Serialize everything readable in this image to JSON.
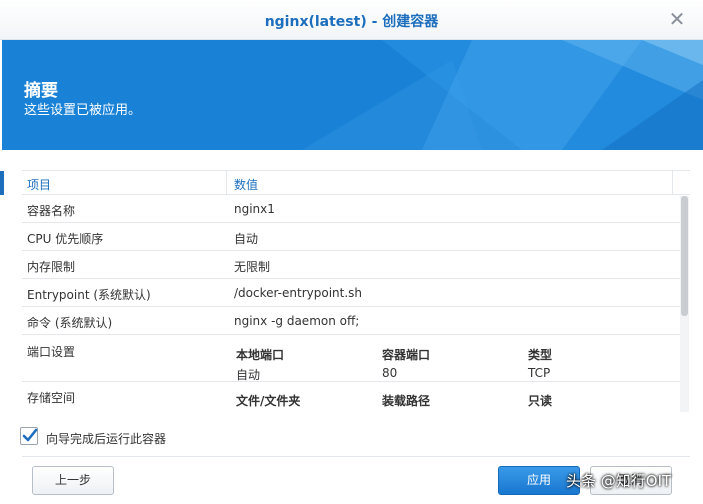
{
  "window": {
    "title": "nginx(latest) - 创建容器",
    "close_glyph": "✕"
  },
  "banner": {
    "heading": "摘要",
    "subheading": "这些设置已被应用。"
  },
  "table": {
    "headers": {
      "item": "项目",
      "value": "数值"
    },
    "rows": [
      {
        "key": "容器名称",
        "value": "nginx1"
      },
      {
        "key": "CPU 优先顺序",
        "value": "自动"
      },
      {
        "key": "内存限制",
        "value": "无限制"
      },
      {
        "key": "Entrypoint (系统默认)",
        "value": "/docker-entrypoint.sh"
      },
      {
        "key": "命令 (系统默认)",
        "value": "nginx -g daemon off;"
      }
    ],
    "ports": {
      "key": "端口设置",
      "headers": [
        "本地端口",
        "容器端口",
        "类型"
      ],
      "values": [
        "自动",
        "80",
        "TCP"
      ]
    },
    "storage": {
      "key": "存储空间",
      "headers": [
        "文件/文件夹",
        "装载路径",
        "只读"
      ]
    }
  },
  "run_after": {
    "label": "向导完成后运行此容器",
    "checked": true
  },
  "buttons": {
    "prev": "上一步",
    "apply": "应用",
    "cancel": "取消"
  },
  "watermark": "头条 @知行OIT",
  "colors": {
    "accent": "#1d6fbd",
    "banner": "#1a82d6",
    "apply_button": "#1877cf"
  }
}
